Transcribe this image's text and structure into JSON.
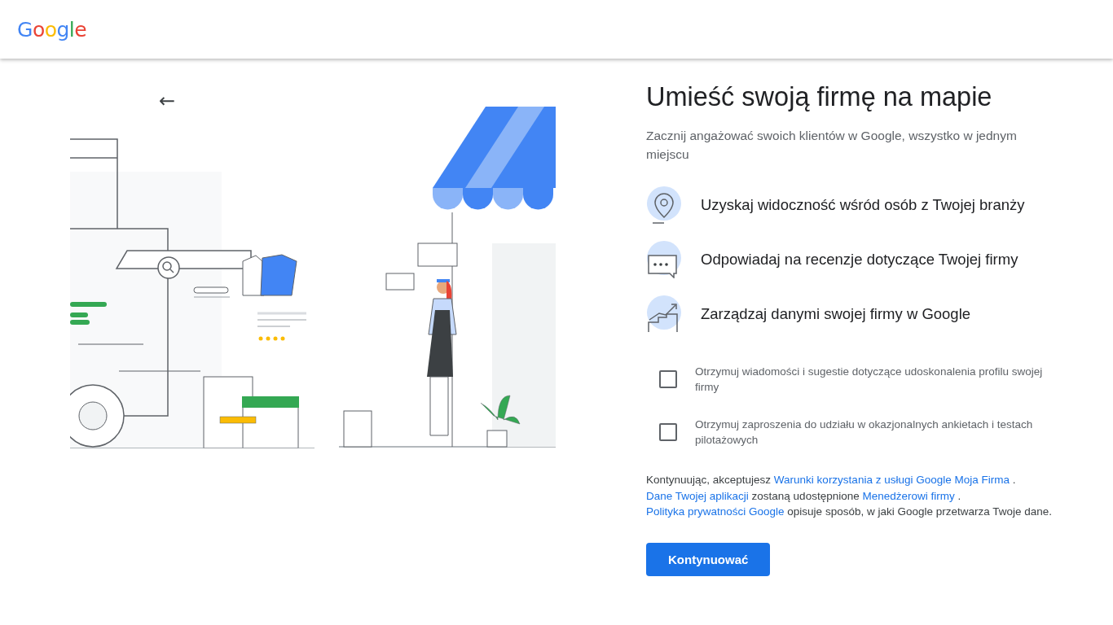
{
  "header": {
    "logo": "Google"
  },
  "back_button": {
    "icon": "←"
  },
  "title": "Umieść swoją firmę na mapie",
  "subtitle": "Zacznij angażować swoich klientów w Google, wszystko w jednym miejscu",
  "features": [
    {
      "kind": "pin",
      "text": "Uzyskaj widoczność wśród osób z Twojej branży"
    },
    {
      "kind": "reviews",
      "text": "Odpowiadaj na recenzje dotyczące Twojej firmy"
    },
    {
      "kind": "growth",
      "text": "Zarządzaj danymi swojej firmy w Google"
    }
  ],
  "options": [
    {
      "label": "Otrzymuj wiadomości i sugestie dotyczące udoskonalenia profilu swojej firmy",
      "checked": false
    },
    {
      "label": "Otrzymuj zaproszenia do udziału w okazjonalnych ankietach i testach pilotażowych",
      "checked": false
    }
  ],
  "legal": [
    {
      "kind": "text",
      "text": "Kontynuując, akceptujesz "
    },
    {
      "kind": "link",
      "text": "Warunki korzystania z usługi Google Moja Firma"
    },
    {
      "kind": "text",
      "text": " . "
    },
    {
      "kind": "link",
      "text": "Dane Twojej aplikacji"
    },
    {
      "kind": "text",
      "text": " zostaną udostępnione "
    },
    {
      "kind": "link",
      "text": "Menedżerowi firmy"
    },
    {
      "kind": "text",
      "text": " . "
    },
    {
      "kind": "link",
      "text": "Polityka prywatności Google"
    },
    {
      "kind": "text",
      "text": " opisuje sposób, w jaki Google przetwarza Twoje dane."
    }
  ],
  "continue_button": "Kontynuować"
}
